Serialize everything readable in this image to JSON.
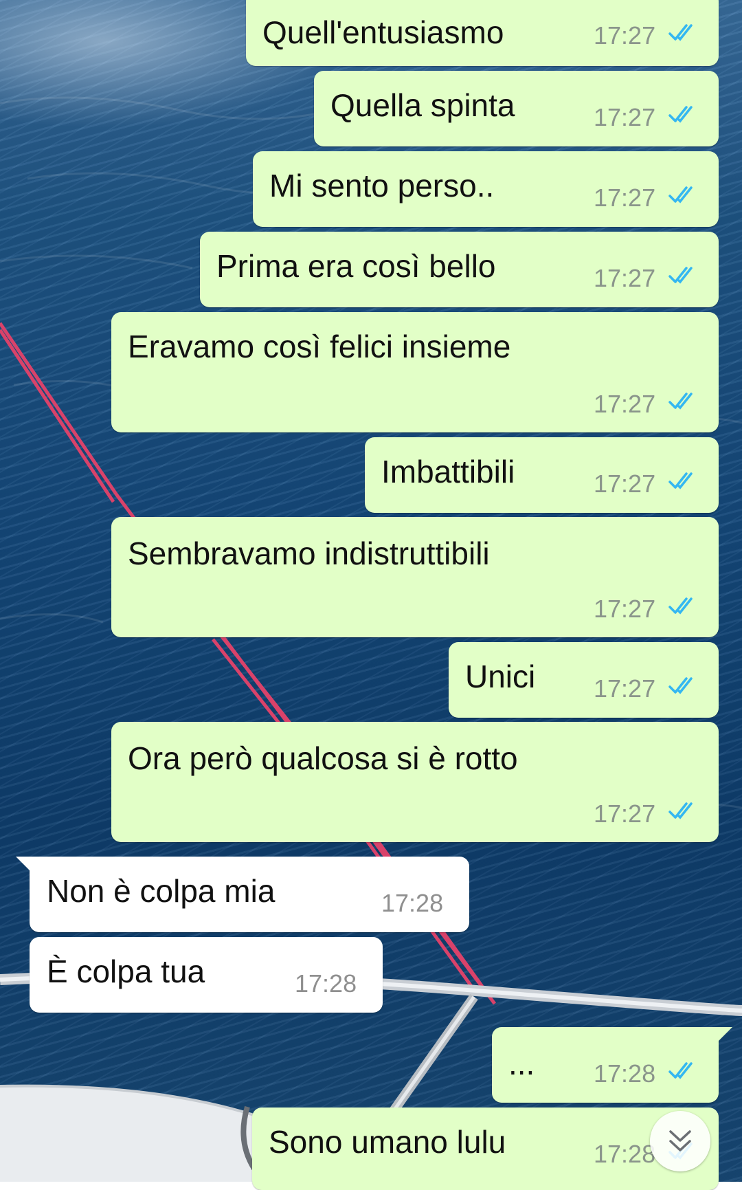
{
  "chat": {
    "messages": [
      {
        "direction": "outgoing",
        "text": "Quell'entusiasmo",
        "time": "17:27",
        "status": "read"
      },
      {
        "direction": "outgoing",
        "text": "Quella spinta",
        "time": "17:27",
        "status": "read"
      },
      {
        "direction": "outgoing",
        "text": "Mi sento perso..",
        "time": "17:27",
        "status": "read"
      },
      {
        "direction": "outgoing",
        "text": "Prima era così bello",
        "time": "17:27",
        "status": "read"
      },
      {
        "direction": "outgoing",
        "text": "Eravamo così felici insieme",
        "time": "17:27",
        "status": "read"
      },
      {
        "direction": "outgoing",
        "text": "Imbattibili",
        "time": "17:27",
        "status": "read"
      },
      {
        "direction": "outgoing",
        "text": "Sembravamo indistruttibili",
        "time": "17:27",
        "status": "read"
      },
      {
        "direction": "outgoing",
        "text": "Unici",
        "time": "17:27",
        "status": "read"
      },
      {
        "direction": "outgoing",
        "text": "Ora però qualcosa si è rotto",
        "time": "17:27",
        "status": "read"
      },
      {
        "direction": "incoming",
        "text": "Non è colpa mia",
        "time": "17:28"
      },
      {
        "direction": "incoming",
        "text": "È colpa tua",
        "time": "17:28"
      },
      {
        "direction": "outgoing",
        "text": "...",
        "time": "17:28",
        "status": "read"
      },
      {
        "direction": "outgoing",
        "text": "Sono umano lulu",
        "time": "17:28",
        "status": "read"
      }
    ],
    "scroll_button_icon": "double-chevron-down-icon"
  },
  "colors": {
    "outgoing_bubble": "#e2ffc7",
    "incoming_bubble": "#ffffff",
    "read_ticks": "#34b7f1",
    "timestamp": "#8a958b"
  }
}
